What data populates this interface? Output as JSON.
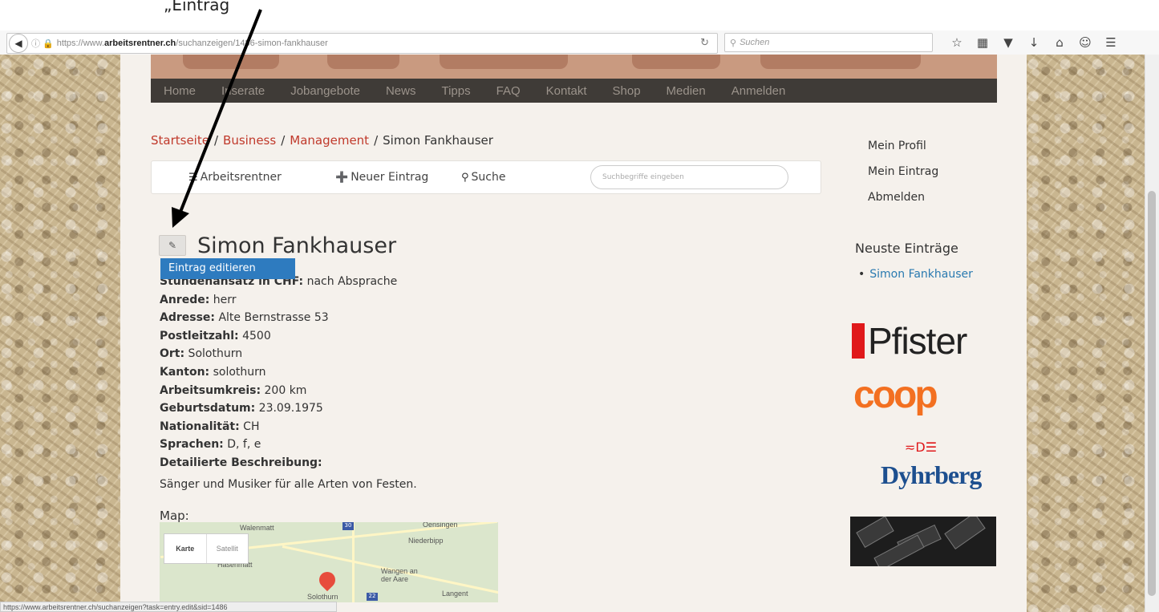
{
  "caption_fragment": "„Eintrag",
  "browser": {
    "url_prefix": "https://www.",
    "url_domain": "arbeitsrentner.ch",
    "url_path": "/suchanzeigen/1486-simon-fankhauser",
    "search_placeholder": "Suchen",
    "status_url": "https://www.arbeitsrentner.ch/suchanzeigen?task=entry.edit&sid=1486"
  },
  "nav": [
    "Home",
    "Inserate",
    "Jobangebote",
    "News",
    "Tipps",
    "FAQ",
    "Kontakt",
    "Shop",
    "Medien",
    "Anmelden"
  ],
  "breadcrumb": {
    "home": "Startseite",
    "cat1": "Business",
    "cat2": "Management",
    "current": "Simon Fankhauser"
  },
  "subnav": {
    "list": "Arbeitsrentner",
    "new_entry": "Neuer Eintrag",
    "search": "Suche",
    "search_placeholder": "Suchbegriffe eingeben"
  },
  "entry": {
    "title": "Simon Fankhauser",
    "tooltip": "Eintrag editieren",
    "fields": [
      {
        "label": "Stundenansatz in CHF:",
        "value": " nach Absprache"
      },
      {
        "label": "Anrede:",
        "value": " herr"
      },
      {
        "label": "Adresse:",
        "value": " Alte Bernstrasse 53"
      },
      {
        "label": "Postleitzahl:",
        "value": " 4500"
      },
      {
        "label": "Ort:",
        "value": " Solothurn"
      },
      {
        "label": "Kanton:",
        "value": " solothurn"
      },
      {
        "label": "Arbeitsumkreis:",
        "value": " 200 km"
      },
      {
        "label": "Geburtsdatum:",
        "value": " 23.09.1975"
      },
      {
        "label": "Nationalität:",
        "value": " CH"
      },
      {
        "label": "Sprachen:",
        "value": " D, f, e"
      },
      {
        "label": "Detailierte Beschreibung:",
        "value": ""
      }
    ],
    "description": "Sänger und Musiker für alle Arten von Festen.",
    "map_label": "Map:",
    "map": {
      "karte": "Karte",
      "satellit": "Satellit",
      "places": [
        "Walenmatt",
        "Niederbipp",
        "Hasenmatt",
        "Wangen an der Aare",
        "Solothurn",
        "Langent",
        "Oensingen"
      ],
      "shields": [
        "30",
        "22"
      ]
    }
  },
  "sidebar": {
    "links": [
      "Mein Profil",
      "Mein Eintrag",
      "Abmelden"
    ],
    "latest_heading": "Neuste Einträge",
    "latest_item": "Simon Fankhauser",
    "logos": {
      "pfister": "Pfister",
      "coop": "coop",
      "dyhrberg": "Dyhrberg"
    }
  },
  "colors": {
    "link_red": "#c0392b",
    "link_blue": "#2a7ab0",
    "tooltip_blue": "#2e7bbf",
    "navbar": "#3f3b37"
  }
}
